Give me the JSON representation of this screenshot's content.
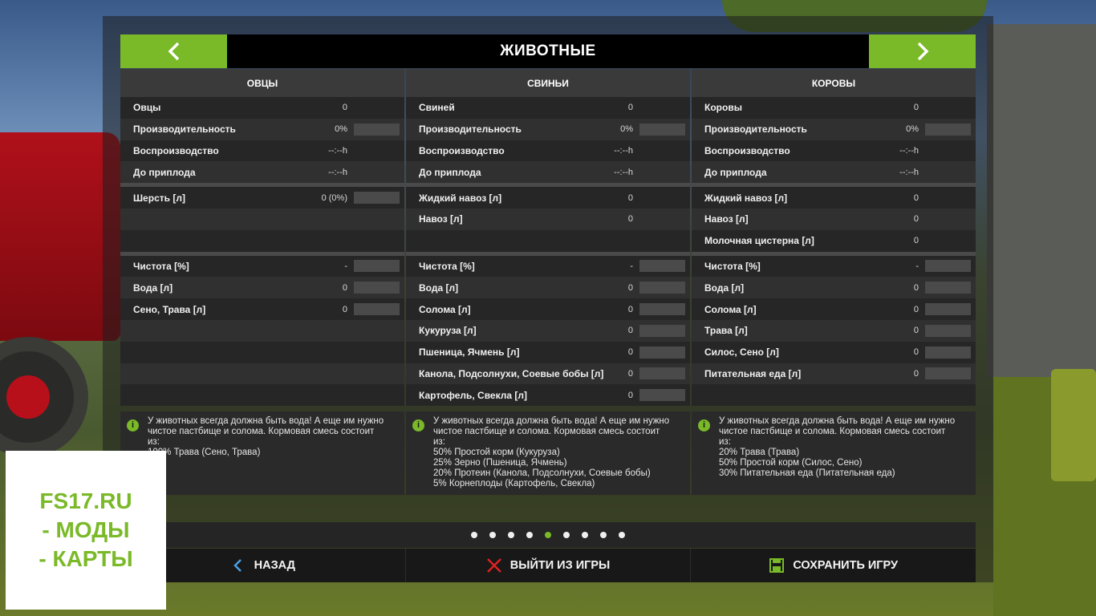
{
  "header": {
    "title": "ЖИВОТНЫЕ"
  },
  "columns": [
    {
      "title": "ОВЦЫ",
      "stats": [
        {
          "label": "Овцы",
          "value": "0",
          "bar": false
        },
        {
          "label": "Производительность",
          "value": "0%",
          "bar": true
        },
        {
          "label": "Воспроизводство",
          "value": "--:--h",
          "bar": false
        },
        {
          "label": "До приплода",
          "value": "--:--h",
          "bar": false
        }
      ],
      "products": [
        {
          "label": "Шерсть [л]",
          "value": "0 (0%)",
          "bar": true
        },
        {
          "label": "",
          "value": "",
          "bar": false
        },
        {
          "label": "",
          "value": "",
          "bar": false
        }
      ],
      "feed": [
        {
          "label": "Чистота [%]",
          "value": "-",
          "bar": true
        },
        {
          "label": "Вода [л]",
          "value": "0",
          "bar": true
        },
        {
          "label": "Сено, Трава [л]",
          "value": "0",
          "bar": true
        },
        {
          "label": "",
          "value": "",
          "bar": false
        },
        {
          "label": "",
          "value": "",
          "bar": false
        },
        {
          "label": "",
          "value": "",
          "bar": false
        },
        {
          "label": "",
          "value": "",
          "bar": false
        }
      ],
      "info": [
        "У животных всегда должна быть вода! А еще им нужно",
        "чистое пастбище и солома. Кормовая смесь состоит",
        "из:",
        "100% Трава (Сено, Трава)"
      ]
    },
    {
      "title": "СВИНЬИ",
      "stats": [
        {
          "label": "Свиней",
          "value": "0",
          "bar": false
        },
        {
          "label": "Производительность",
          "value": "0%",
          "bar": true
        },
        {
          "label": "Воспроизводство",
          "value": "--:--h",
          "bar": false
        },
        {
          "label": "До приплода",
          "value": "--:--h",
          "bar": false
        }
      ],
      "products": [
        {
          "label": "Жидкий навоз [л]",
          "value": "0",
          "bar": false
        },
        {
          "label": "Навоз [л]",
          "value": "0",
          "bar": false
        },
        {
          "label": "",
          "value": "",
          "bar": false
        }
      ],
      "feed": [
        {
          "label": "Чистота [%]",
          "value": "-",
          "bar": true
        },
        {
          "label": "Вода [л]",
          "value": "0",
          "bar": true
        },
        {
          "label": "Солома [л]",
          "value": "0",
          "bar": true
        },
        {
          "label": "Кукуруза [л]",
          "value": "0",
          "bar": true
        },
        {
          "label": "Пшеница, Ячмень [л]",
          "value": "0",
          "bar": true
        },
        {
          "label": "Канола, Подсолнухи, Соевые бобы [л]",
          "value": "0",
          "bar": true
        },
        {
          "label": "Картофель, Свекла [л]",
          "value": "0",
          "bar": true
        }
      ],
      "info": [
        "У животных всегда должна быть вода! А еще им нужно",
        "чистое пастбище и солома. Кормовая смесь состоит",
        "из:",
        "50% Простой корм (Кукуруза)",
        "25% Зерно (Пшеница, Ячмень)",
        "20% Протеин (Канола, Подсолнухи, Соевые бобы)",
        "5% Корнеплоды (Картофель, Свекла)"
      ]
    },
    {
      "title": "КОРОВЫ",
      "stats": [
        {
          "label": "Коровы",
          "value": "0",
          "bar": false
        },
        {
          "label": "Производительность",
          "value": "0%",
          "bar": true
        },
        {
          "label": "Воспроизводство",
          "value": "--:--h",
          "bar": false
        },
        {
          "label": "До приплода",
          "value": "--:--h",
          "bar": false
        }
      ],
      "products": [
        {
          "label": "Жидкий навоз [л]",
          "value": "0",
          "bar": false
        },
        {
          "label": "Навоз [л]",
          "value": "0",
          "bar": false
        },
        {
          "label": "Молочная цистерна [л]",
          "value": "0",
          "bar": false
        }
      ],
      "feed": [
        {
          "label": "Чистота [%]",
          "value": "-",
          "bar": true
        },
        {
          "label": "Вода [л]",
          "value": "0",
          "bar": true
        },
        {
          "label": "Солома [л]",
          "value": "0",
          "bar": true
        },
        {
          "label": "Трава [л]",
          "value": "0",
          "bar": true
        },
        {
          "label": "Силос, Сено [л]",
          "value": "0",
          "bar": true
        },
        {
          "label": "Питательная еда [л]",
          "value": "0",
          "bar": true
        },
        {
          "label": "",
          "value": "",
          "bar": false
        }
      ],
      "info": [
        "У животных всегда должна быть вода! А еще им нужно",
        "чистое пастбище и солома. Кормовая смесь состоит",
        "из:",
        "20% Трава (Трава)",
        "50% Простой корм (Силос, Сено)",
        "30% Питательная еда (Питательная еда)"
      ]
    }
  ],
  "pagination": {
    "count": 9,
    "active": 4
  },
  "footer": {
    "back_label": "НАЗАД",
    "quit_label": "ВЫЙТИ ИЗ ИГРЫ",
    "save_label": "СОХРАНИТЬ ИГРУ"
  },
  "watermark": [
    "FS17.RU",
    "- МОДЫ",
    "- КАРТЫ"
  ],
  "colors": {
    "accent": "#7ab928",
    "panel": "#262626",
    "quit_icon": "#e02020"
  },
  "icons": {
    "prev": "chevron-left-icon",
    "next": "chevron-right-icon",
    "info": "info-icon",
    "back": "chevron-left-icon",
    "quit": "close-icon",
    "save": "floppy-disk-icon"
  }
}
